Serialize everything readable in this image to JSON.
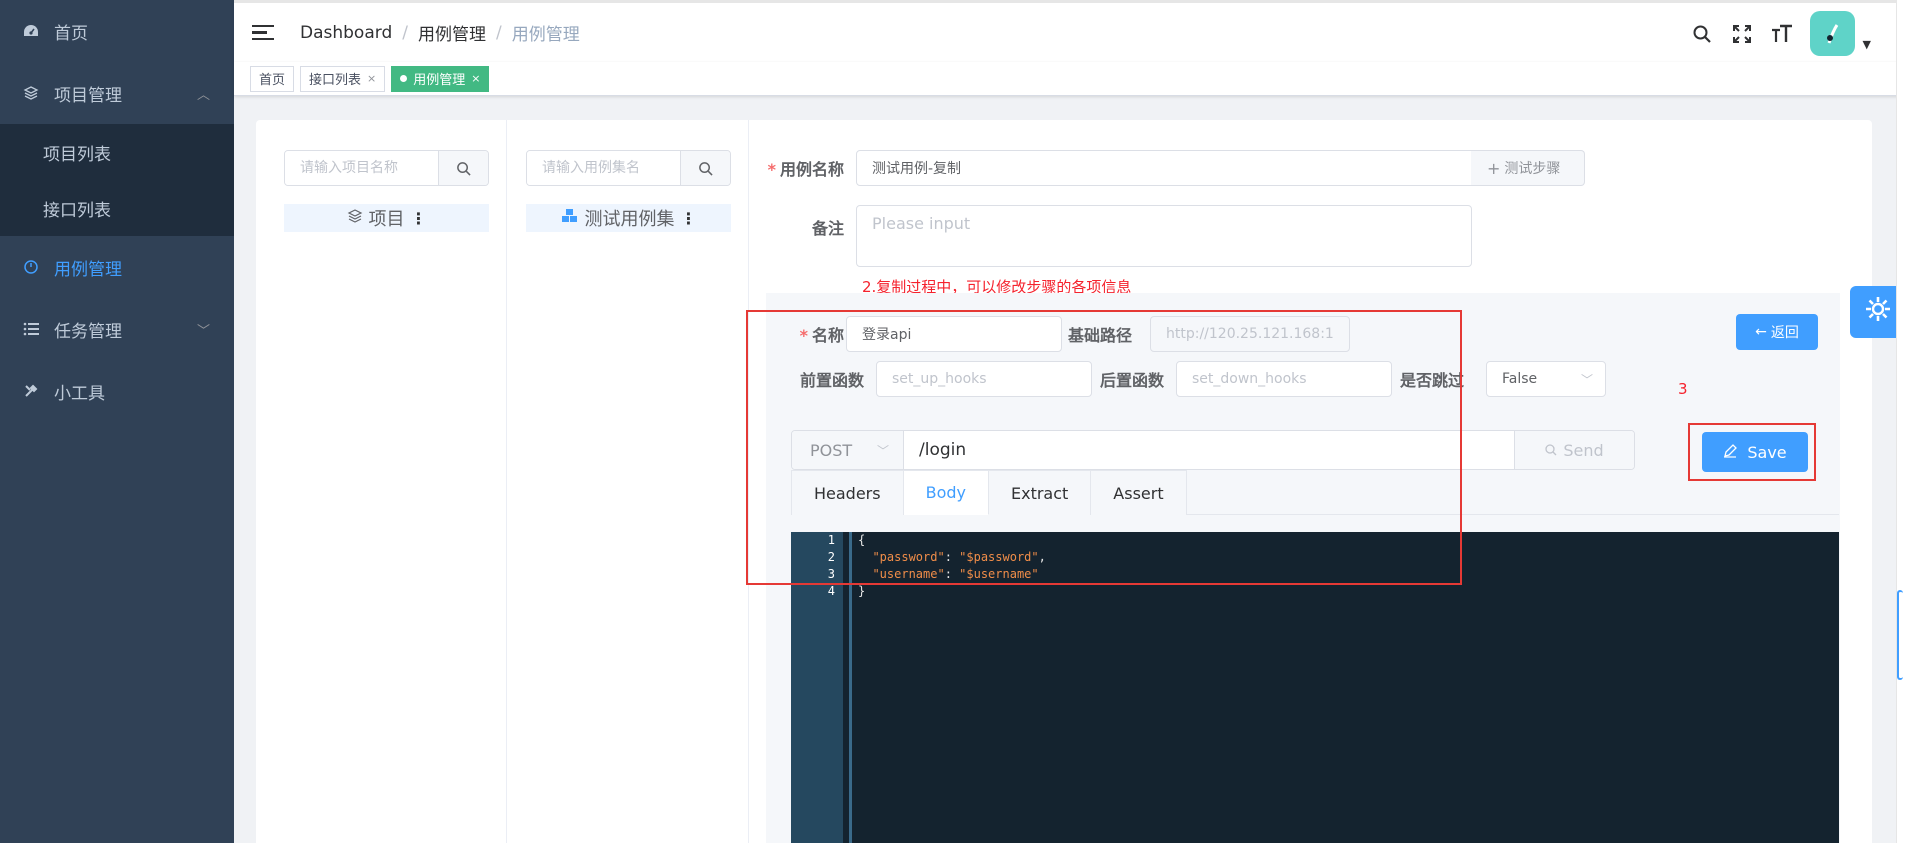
{
  "sidebar": {
    "items": [
      {
        "label": "首页",
        "icon": "dashboard-icon"
      },
      {
        "label": "项目管理",
        "icon": "layers-icon",
        "expanded": true
      },
      {
        "label": "用例管理",
        "icon": "target-icon",
        "active": true
      },
      {
        "label": "任务管理",
        "icon": "list-icon"
      },
      {
        "label": "小工具",
        "icon": "tools-icon"
      }
    ],
    "subitems": [
      "项目列表",
      "接口列表"
    ],
    "colors": {
      "background": "#304156",
      "submenu": "#1f2d3d",
      "active": "#409eff"
    }
  },
  "topbar": {
    "breadcrumb": [
      "Dashboard",
      "用例管理",
      "用例管理"
    ]
  },
  "tags": [
    {
      "label": "首页",
      "active": false
    },
    {
      "label": "接口列表",
      "active": false,
      "close": "×"
    },
    {
      "label": "用例管理",
      "active": true,
      "close": "×"
    }
  ],
  "left_panel": {
    "search_placeholder": "请输入项目名称",
    "tree_label": "项目"
  },
  "mid_panel": {
    "search_placeholder": "请输入用例集名",
    "tree_label": "测试用例集"
  },
  "form": {
    "case_name_label": "用例名称",
    "case_name_value": "测试用例-复制",
    "test_steps_button": "测试步骤",
    "remark_label": "备注",
    "remark_placeholder": "Please input",
    "annotation_2": "2.复制过程中，可以修改步骤的各项信息",
    "annotation_3": "3"
  },
  "step": {
    "name_label": "名称",
    "name_value": "登录api",
    "base_path_label": "基础路径",
    "base_path_value": "http://120.25.121.168:1",
    "back_button": "返回",
    "setup_label": "前置函数",
    "setup_placeholder": "set_up_hooks",
    "teardown_label": "后置函数",
    "teardown_placeholder": "set_down_hooks",
    "skip_label": "是否跳过",
    "skip_value": "False",
    "method": "POST",
    "url": "/login",
    "send_button": "Send",
    "save_button": "Save",
    "tabs": [
      "Headers",
      "Body",
      "Extract",
      "Assert"
    ],
    "active_tab": "Body"
  },
  "editor": {
    "line_numbers": [
      "1",
      "2",
      "3",
      "4"
    ],
    "lines": [
      {
        "text": "{"
      },
      {
        "key": "\"password\"",
        "value": "\"$password\"",
        "trail": ","
      },
      {
        "key": "\"username\"",
        "value": "\"$username\"",
        "trail": ""
      },
      {
        "text": "}"
      }
    ]
  }
}
